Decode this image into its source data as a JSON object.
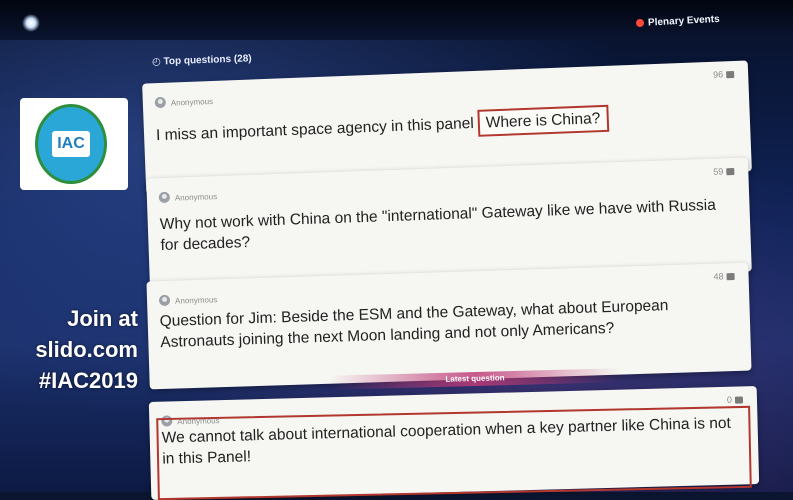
{
  "top_bar": {
    "event_label": "Plenary Events"
  },
  "sidebar": {
    "logo_text": "IAC",
    "join_lines": [
      "Join at",
      "slido.com",
      "#IAC2019"
    ]
  },
  "panel": {
    "header": "Top questions (28)",
    "latest_label": "Latest question"
  },
  "questions": [
    {
      "author": "Anonymous",
      "likes": "96",
      "text": "I miss an important space agency in this panel",
      "highlight": "Where is China?"
    },
    {
      "author": "Anonymous",
      "likes": "59",
      "text": "Why not work with China on the \"international\" Gateway like we have with Russia for decades?"
    },
    {
      "author": "Anonymous",
      "likes": "48",
      "text": "Question for Jim: Beside the ESM and the Gateway, what about European Astronauts joining the next Moon landing and not only Americans?"
    },
    {
      "author": "Anonymous",
      "likes": "0",
      "text": "We cannot talk about international cooperation when a key partner like China is not in this Panel!"
    }
  ],
  "colors": {
    "highlight_border": "#b1372f",
    "live_dot": "#ff4a3a",
    "background": "#10245a"
  },
  "icons": [
    "avatar-icon",
    "thumbs-up-icon",
    "clock-icon",
    "live-dot-icon"
  ]
}
